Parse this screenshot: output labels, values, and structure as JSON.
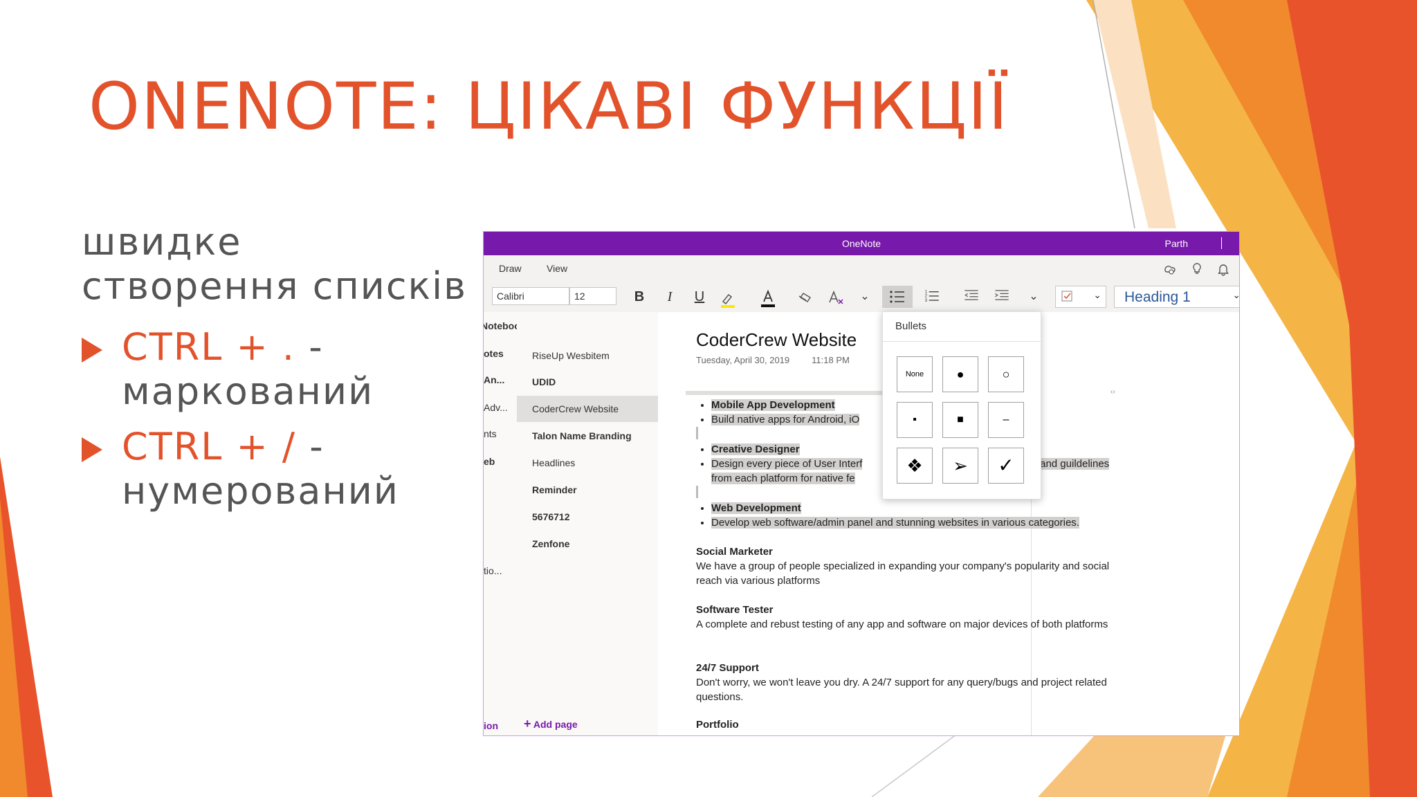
{
  "slide": {
    "title": "ONENOTE: ЦІКАВІ ФУНКЦІЇ",
    "lead": "швидке створення списків",
    "bullets": [
      {
        "key": "CTRL + .",
        "rest": " - маркований"
      },
      {
        "key": "CTRL + /",
        "rest": " - нумерований"
      }
    ],
    "colors": {
      "accent": "#E2522B",
      "text": "#555555",
      "orange_light": "#F5B446",
      "orange_mid": "#F08A2C",
      "orange_dark": "#E8532B"
    }
  },
  "app": {
    "title": "OneNote",
    "user": "Parth",
    "accent": "#7719AA",
    "menu": [
      "Draw",
      "View"
    ],
    "menu_icons": [
      "sync-icon",
      "lightbulb-icon",
      "bell-icon"
    ],
    "font_name": "Calibri",
    "font_size": "12",
    "style": "Heading 1",
    "notebook": "Notebook",
    "sections": [
      "otes",
      "An...",
      "Adv...",
      "nts",
      "eb",
      "tio..."
    ],
    "add_section": "ion",
    "pages": [
      {
        "label": "RiseUp Wesbitem",
        "bold": false
      },
      {
        "label": "UDID",
        "bold": true
      },
      {
        "label": "CoderCrew Website",
        "bold": false,
        "active": true
      },
      {
        "label": "Talon Name Branding",
        "bold": true
      },
      {
        "label": "Headlines",
        "bold": false
      },
      {
        "label": "Reminder",
        "bold": true
      },
      {
        "label": "5676712",
        "bold": true
      },
      {
        "label": "Zenfone",
        "bold": true
      }
    ],
    "add_page": "Add page"
  },
  "page": {
    "title": "CoderCrew Website",
    "date": "Tuesday, April 30, 2019",
    "time": "11:18 PM",
    "bul1_h": "Mobile App Development",
    "bul1_t": "Build native apps for Android, iO",
    "bul2_h": "Creative Designer",
    "bul2_t1": "Design every piece of User Interf",
    "bul2_t1b": "s and guildelines",
    "bul2_t2": "from each platform for native fe",
    "bul3_h": "Web Development",
    "bul3_t": "Develop web software/admin panel and stunning websites in various categories.",
    "s1_h": "Social Marketer",
    "s1_t": "We have a group of people specialized in expanding your company's popularity and social reach via various platforms",
    "s2_h": "Software Tester",
    "s2_t": "A complete and rebust testing of any app and software on major devices of both platforms",
    "s3_h": "24/7 Support",
    "s3_t": "Don't worry, we won't leave you dry. A 24/7 support for any query/bugs and project related questions.",
    "s4_h": "Portfolio"
  },
  "bullets_menu": {
    "title": "Bullets",
    "options": [
      "None",
      "●",
      "○",
      "▪",
      "■",
      "–",
      "❖",
      "➢",
      "✓"
    ]
  }
}
